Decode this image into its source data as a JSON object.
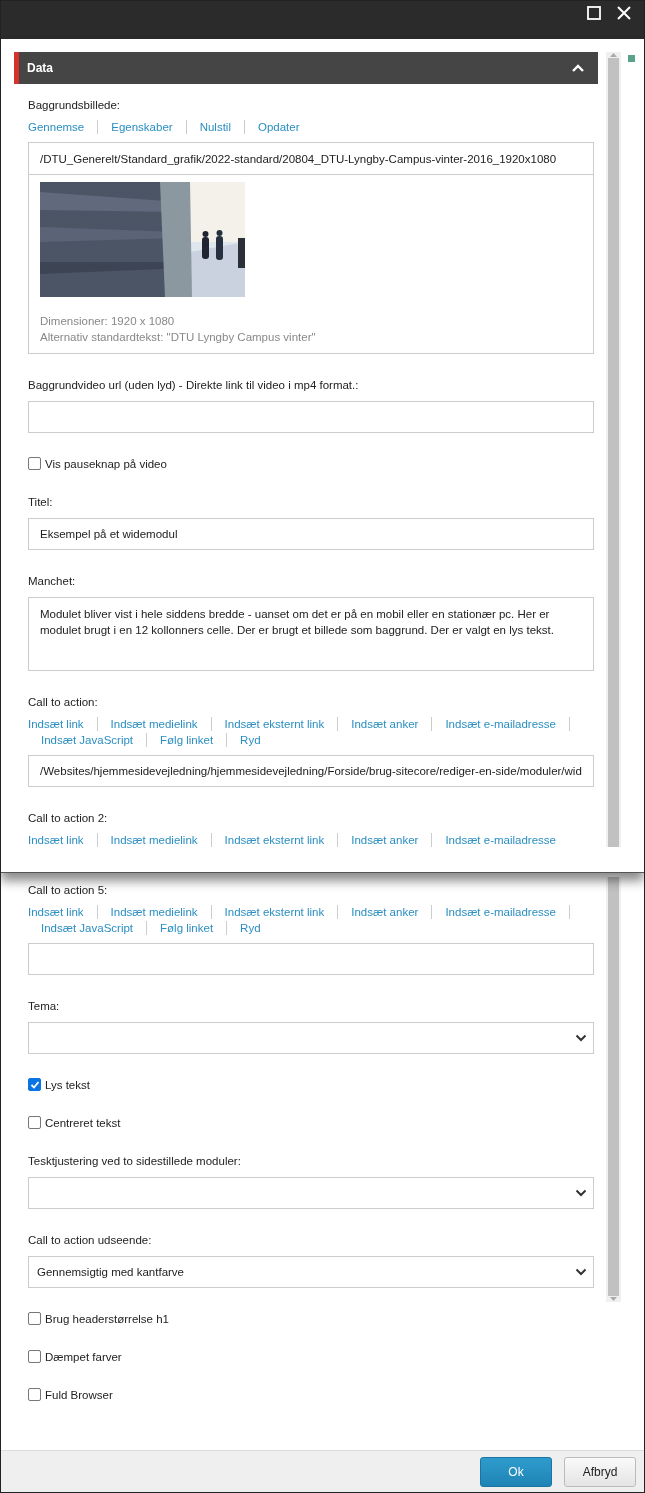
{
  "upper_screen": {
    "section": {
      "title": "Data",
      "expanded": true
    },
    "fields": [
      {
        "label": "Baggrundsbillede:",
        "actions": [
          "Gennemse",
          "Egenskaber",
          "Nulstil",
          "Opdater"
        ],
        "path": "/DTU_Generelt/Standard_grafik/2022-standard/20804_DTU-Lyngby-Campus-vinter-2016_1920x1080",
        "dimensions": "Dimensioner: 1920 x 1080",
        "alt_text": "Alternativ standardtekst: \"DTU Lyngby Campus vinter\""
      },
      {
        "kind": "text",
        "label": "Baggrundvideo url (uden lyd) - Direkte link til video i mp4 format.:"
      },
      {
        "kind": "checkbox",
        "label": "Vis pauseknap på video",
        "checked": false
      },
      {
        "kind": "text",
        "label": "Titel:",
        "value": "Eksempel på et widemodul"
      },
      {
        "kind": "textarea",
        "label": "Manchet:",
        "value": "Modulet bliver vist i hele siddens bredde - uanset om det er på en mobil eller en stationær pc. Her er modulet brugt i en 12 kollonners celle. Der er brugt et billede som baggrund. Der er valgt en lys tekst."
      },
      {
        "kind": "link",
        "label": "Call to action:",
        "actions": [
          "Indsæt link",
          "Indsæt medielink",
          "Indsæt eksternt link",
          "Indsæt anker",
          "Indsæt e-mailadresse",
          "Indsæt JavaScript",
          "Følg linket",
          "Ryd"
        ],
        "value": "/Websites/hjemmesidevejledning/hjemmesidevejledning/Forside/brug-sitecore/rediger-en-side/moduler/wid"
      },
      {
        "kind": "link",
        "label": "Call to action 2:",
        "actions": [
          "Indsæt link",
          "Indsæt medielink",
          "Indsæt eksternt link",
          "Indsæt anker",
          "Indsæt e-mailadresse"
        ]
      }
    ]
  },
  "lower_screen": {
    "fields": [
      {
        "kind": "link",
        "label": "Call to action 5:",
        "actions": [
          "Indsæt link",
          "Indsæt medielink",
          "Indsæt eksternt link",
          "Indsæt anker",
          "Indsæt e-mailadresse",
          "Indsæt JavaScript",
          "Følg linket",
          "Ryd"
        ]
      },
      {
        "kind": "select",
        "label": "Tema:"
      },
      {
        "kind": "checkbox",
        "label": "Lys tekst",
        "checked": true
      },
      {
        "kind": "checkbox",
        "label": "Centreret tekst",
        "checked": false
      },
      {
        "kind": "select",
        "label": "Tesktjustering ved to sidestillede moduler:"
      },
      {
        "kind": "select",
        "label": "Call to action udseende:",
        "value": "Gennemsigtig med kantfarve"
      },
      {
        "kind": "checkbox",
        "label": "Brug headerstørrelse h1",
        "checked": false
      },
      {
        "kind": "checkbox",
        "label": "Dæmpet farver",
        "checked": false
      },
      {
        "kind": "checkbox",
        "label": "Fuld Browser",
        "checked": false
      }
    ],
    "buttons": [
      {
        "label": "Ok",
        "primary": true
      },
      {
        "label": "Afbryd",
        "primary": false
      }
    ]
  }
}
